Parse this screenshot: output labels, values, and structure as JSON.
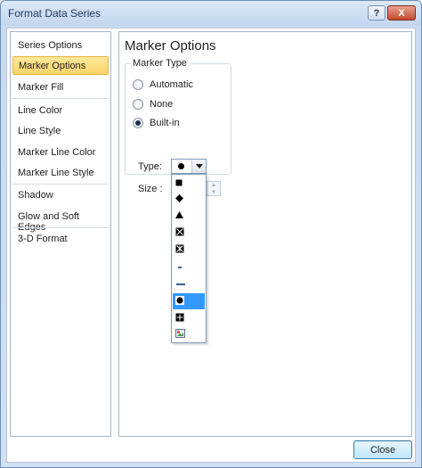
{
  "window": {
    "title": "Format Data Series",
    "help_label": "?",
    "close_label": "X"
  },
  "nav": {
    "items": [
      {
        "label": "Series Options",
        "selected": false
      },
      {
        "label": "Marker Options",
        "selected": true
      },
      {
        "label": "Marker Fill",
        "selected": false
      },
      {
        "label": "Line Color",
        "selected": false
      },
      {
        "label": "Line Style",
        "selected": false
      },
      {
        "label": "Marker Line Color",
        "selected": false
      },
      {
        "label": "Marker Line Style",
        "selected": false
      },
      {
        "label": "Shadow",
        "selected": false
      },
      {
        "label": "Glow and Soft Edges",
        "selected": false
      },
      {
        "label": "3-D Format",
        "selected": false
      }
    ]
  },
  "pane": {
    "title": "Marker Options",
    "group_title": "Marker Type",
    "radios": [
      {
        "label": "Automatic",
        "checked": false
      },
      {
        "label": "None",
        "checked": false
      },
      {
        "label": "Built-in",
        "checked": true
      }
    ],
    "type_label": "Type:",
    "type_value_icon": "circle-marker-icon",
    "size_label": "Size :"
  },
  "dropdown": {
    "options": [
      {
        "icon": "square-marker-icon",
        "selected": false
      },
      {
        "icon": "diamond-marker-icon",
        "selected": false
      },
      {
        "icon": "triangle-marker-icon",
        "selected": false
      },
      {
        "icon": "x-marker-icon",
        "selected": false
      },
      {
        "icon": "star-marker-icon",
        "selected": false
      },
      {
        "icon": "short-dash-marker-icon",
        "selected": false
      },
      {
        "icon": "long-dash-marker-icon",
        "selected": false
      },
      {
        "icon": "circle-marker-icon",
        "selected": true
      },
      {
        "icon": "plus-marker-icon",
        "selected": false
      },
      {
        "icon": "picture-marker-icon",
        "selected": false
      }
    ]
  },
  "footer": {
    "close_label": "Close"
  },
  "colors": {
    "selected_nav": "#fbd568",
    "selected_option": "#3399ff",
    "accent_border": "#7f9db9"
  }
}
